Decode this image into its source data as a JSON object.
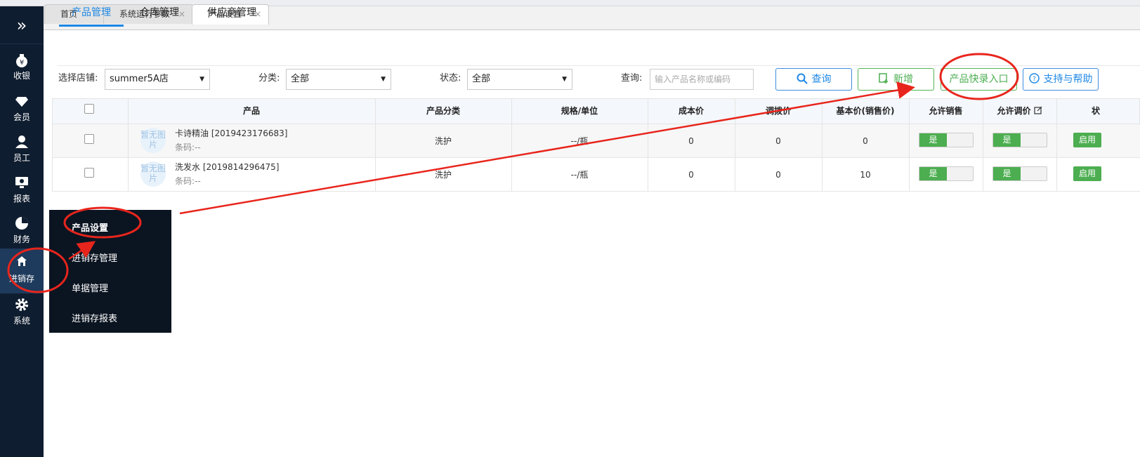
{
  "sidebar": {
    "collapse_glyph": "»",
    "items": [
      {
        "label": "收银",
        "icon": "cashier-icon"
      },
      {
        "label": "会员",
        "icon": "diamond-icon"
      },
      {
        "label": "员工",
        "icon": "person-icon"
      },
      {
        "label": "报表",
        "icon": "monitor-icon"
      },
      {
        "label": "财务",
        "icon": "pie-chart-icon"
      },
      {
        "label": "进销存",
        "icon": "home-icon"
      },
      {
        "label": "系统",
        "icon": "gear-icon"
      }
    ]
  },
  "page_tabs": [
    {
      "label": "首页",
      "close": ""
    },
    {
      "label": "系统运行参数",
      "close": "×"
    },
    {
      "label": "产品设置",
      "close": "×"
    }
  ],
  "sub_tabs": [
    "产品管理",
    "仓库管理",
    "供应商管理"
  ],
  "filters": {
    "store_label": "选择店铺:",
    "store_value": "summer5A店",
    "category_label": "分类:",
    "category_value": "全部",
    "status_label": "状态:",
    "status_value": "全部",
    "query_label": "查询:",
    "query_placeholder": "输入产品名称或编码",
    "arrow": "▼"
  },
  "buttons": {
    "search": "查询",
    "add": "新增",
    "quick_entry": "产品快录入口",
    "help": "支持与帮助"
  },
  "table": {
    "headers": [
      "产品",
      "产品分类",
      "规格/单位",
      "成本价",
      "调拨价",
      "基本价(销售价)",
      "允许销售",
      "允许调价",
      "状"
    ],
    "no_image": "暂无图片",
    "barcode_label": "条码:--",
    "rows": [
      {
        "name": "卡诗精油 [2019423176683]",
        "category": "洗护",
        "spec": "--/瓶",
        "cost": "0",
        "transfer": "0",
        "base": "0",
        "allow_sale": "是",
        "allow_adjust": "是",
        "status": "启用"
      },
      {
        "name": "洗发水 [2019814296475]",
        "category": "洗护",
        "spec": "--/瓶",
        "cost": "0",
        "transfer": "0",
        "base": "10",
        "allow_sale": "是",
        "allow_adjust": "是",
        "status": "启用"
      }
    ]
  },
  "flyout_menu": [
    "产品设置",
    "进销存管理",
    "单据管理",
    "进销存报表"
  ],
  "colors": {
    "sidebar_bg": "#0f1d30",
    "accent_blue": "#1e88e5",
    "success_green": "#4cae50",
    "annotation_red": "#e8251c"
  }
}
